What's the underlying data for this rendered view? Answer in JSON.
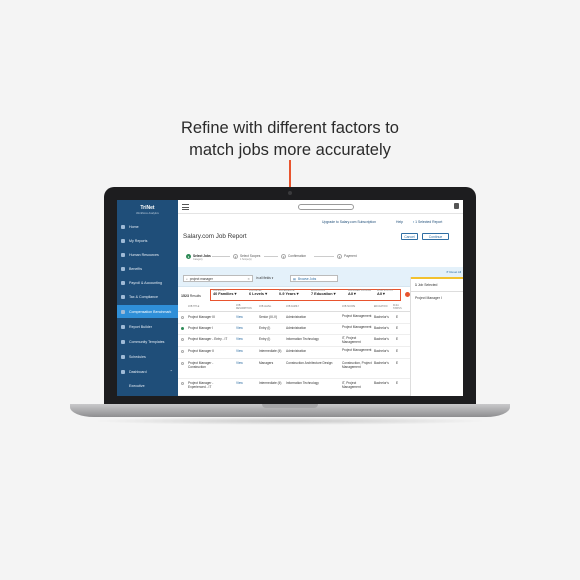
{
  "caption": {
    "line1": "Refine with different factors to",
    "line2": "match jobs more accurately"
  },
  "colors": {
    "accent": "#e8542e",
    "sidebar": "#1f4e79",
    "sidebar_active": "#2f8fd8",
    "link": "#2f6ea3",
    "step_active": "#2e8b57",
    "panel_accent": "#f2c12e"
  },
  "app": {
    "logo": "TriNet",
    "logo_sub": "Workforce Analytics",
    "sidebar": {
      "items": [
        {
          "label": "Home",
          "icon": "home-icon"
        },
        {
          "label": "My Reports",
          "icon": "reports-icon"
        },
        {
          "label": "Human Resources",
          "icon": "people-icon"
        },
        {
          "label": "Benefits",
          "icon": "benefits-icon"
        },
        {
          "label": "Payroll & Accounting",
          "icon": "payroll-icon"
        },
        {
          "label": "Tax & Compliance",
          "icon": "tax-icon"
        },
        {
          "label": "Compensation Benchmark",
          "icon": "benchmark-icon",
          "active": true
        },
        {
          "label": "Report Builder",
          "icon": "builder-icon"
        },
        {
          "label": "Community Templates",
          "icon": "templates-icon"
        },
        {
          "label": "Schedules",
          "icon": "calendar-icon"
        },
        {
          "label": "Dashboard",
          "icon": "dashboard-icon",
          "expandable": true
        },
        {
          "label": "Executive",
          "icon": ""
        }
      ]
    },
    "topbar": {
      "upgrade_link": "Upgrade to Salary.com Subscription",
      "help": "Help",
      "selected_report": "1 Selected Report"
    },
    "page_title": "Salary.com Job Report",
    "buttons": {
      "cancel": "Cancel",
      "continue": "Continue"
    },
    "steps": [
      {
        "num": "1",
        "label": "Select Jobs",
        "sub": "Category",
        "active": true
      },
      {
        "num": "2",
        "label": "Select Scopes",
        "sub": "1 Scope(s)"
      },
      {
        "num": "3",
        "label": "Confirmation",
        "sub": ""
      },
      {
        "num": "4",
        "label": "Payment",
        "sub": ""
      }
    ],
    "search": {
      "value": "project manager",
      "in_fields": "in all fields",
      "browse": "Browse Jobs",
      "reset": "Reset All"
    },
    "results": {
      "count": "1523",
      "label": "Results"
    },
    "filters": [
      {
        "label": "CATEGORY",
        "value": "40 Families"
      },
      {
        "label": "JOB LEVEL",
        "value": "6 Levels"
      },
      {
        "label": "EXPERIENCE",
        "value": "0-9 Years"
      },
      {
        "label": "EDUCATION",
        "value": "7 Education"
      },
      {
        "label": "MANAGER PROFILE",
        "value": "All"
      },
      {
        "label": "FLSA STATUS",
        "value": "All"
      }
    ],
    "table": {
      "headers": [
        "JOB TITLE",
        "JOB DESCRIPTION",
        "JOB LEVEL",
        "JOB FAMILY",
        "JOB SCOPE",
        "EDUCATION",
        "FLSA STATUS"
      ],
      "rows": [
        {
          "title": "Project Manager III",
          "desc": "View",
          "level": "Senior (III-V)",
          "family": "Administration",
          "scope": "Project Management",
          "edu": "Bachelor's",
          "flsa": "E",
          "selected": false
        },
        {
          "title": "Project Manager I",
          "desc": "View",
          "level": "Entry (I)",
          "family": "Administration",
          "scope": "Project Management",
          "edu": "Bachelor's",
          "flsa": "E",
          "selected": true
        },
        {
          "title": "Project Manager - Entry - IT",
          "desc": "View",
          "level": "Entry (I)",
          "family": "Information Technology",
          "scope": "IT, Project Management",
          "edu": "Bachelor's",
          "flsa": "E",
          "selected": false
        },
        {
          "title": "Project Manager II",
          "desc": "View",
          "level": "Intermediate (II)",
          "family": "Administration",
          "scope": "Project Management",
          "edu": "Bachelor's",
          "flsa": "E",
          "selected": false
        },
        {
          "title": "Project Manager - Construction",
          "desc": "View",
          "level": "Managers",
          "family": "Construction Architecture Design",
          "scope": "Construction, Project Management",
          "edu": "Bachelor's",
          "flsa": "E",
          "selected": false
        },
        {
          "title": "Project Manager - Experienced - IT",
          "desc": "View",
          "level": "Intermediate (II)",
          "family": "Information Technology",
          "scope": "IT, Project Management",
          "edu": "Bachelor's",
          "flsa": "E",
          "selected": false
        }
      ]
    },
    "panel": {
      "count": "1",
      "title": "Job Selected",
      "item": "Project Manager I"
    }
  }
}
